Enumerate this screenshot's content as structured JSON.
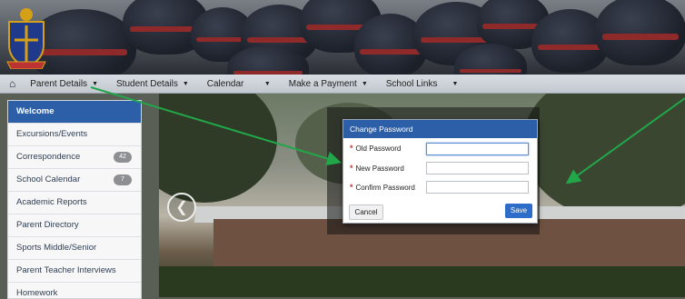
{
  "nav": {
    "home_icon": "home-icon",
    "items": [
      {
        "label": "Parent Details"
      },
      {
        "label": "Student Details"
      },
      {
        "label": "Calendar"
      },
      {
        "label": "Make a Payment"
      },
      {
        "label": "School Links"
      }
    ]
  },
  "sidebar": {
    "items": [
      {
        "label": "Welcome",
        "active": true
      },
      {
        "label": "Excursions/Events"
      },
      {
        "label": "Correspondence",
        "badge": "42"
      },
      {
        "label": "School Calendar",
        "badge": "7"
      },
      {
        "label": "Academic Reports"
      },
      {
        "label": "Parent Directory"
      },
      {
        "label": "Sports Middle/Senior"
      },
      {
        "label": "Parent Teacher Interviews"
      },
      {
        "label": "Homework"
      }
    ]
  },
  "modal": {
    "title": "Change Password",
    "required_marker": "*",
    "fields": [
      {
        "label": "Old Password",
        "value": ""
      },
      {
        "label": "New Password",
        "value": ""
      },
      {
        "label": "Confirm Password",
        "value": ""
      }
    ],
    "cancel_label": "Cancel",
    "save_label": "Save"
  },
  "colors": {
    "accent": "#2d5fa8",
    "arrow": "#22a64a"
  }
}
